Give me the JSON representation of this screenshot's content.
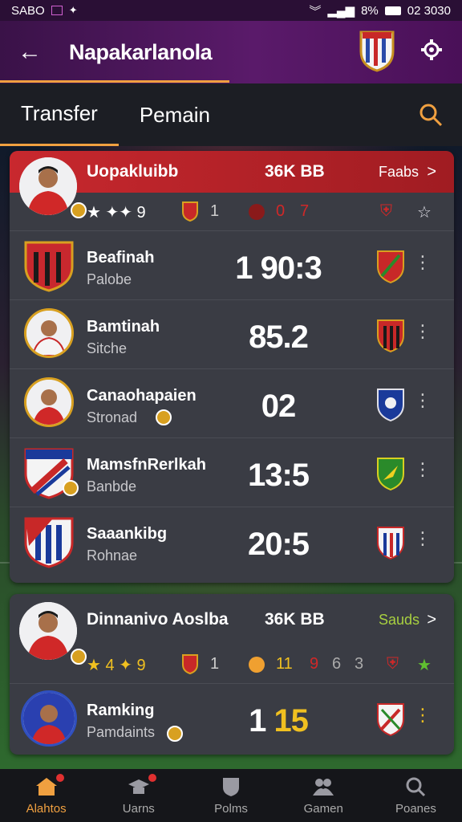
{
  "status_bar": {
    "carrier": "SABO",
    "battery": "8%",
    "time": "02 3030"
  },
  "app_bar": {
    "title": "Napakarlanola"
  },
  "tabs": [
    {
      "label": "Transfer"
    },
    {
      "label": "Pemain"
    }
  ],
  "card1": {
    "header": {
      "name": "Uopakluibb",
      "value": "36K BB",
      "link": "Faabs",
      "chevron": ">"
    },
    "subrow": {
      "stars": "★ ✦✦ 9",
      "num1": "1",
      "dot_num": "0",
      "num2": "7"
    },
    "rows": [
      {
        "name": "Beafinah",
        "sub": "Palobe",
        "score": "1 90:3"
      },
      {
        "name": "Bamtinah",
        "sub": "Sitche",
        "score": "85.2"
      },
      {
        "name": "Canaohapaien",
        "sub": "Stronad",
        "score": "02"
      },
      {
        "name": "MamsfnRerlkah",
        "sub": "Banbde",
        "score": "13:5"
      },
      {
        "name": "Saaankibg",
        "sub": "Rohnae",
        "score": "20:5"
      }
    ]
  },
  "card2": {
    "header": {
      "name": "Dinnanivo Aoslba",
      "value": "36K BB",
      "link": "Sauds",
      "chevron": ">"
    },
    "subrow": {
      "stars": "★ 4 ✦ 9",
      "num1": "1",
      "num2": "11",
      "num3": "9",
      "num4": "6",
      "num5": "3"
    },
    "rows": [
      {
        "name": "Ramking",
        "sub": "Pamdaints",
        "score_a": "1",
        "score_b": "15"
      }
    ]
  },
  "bottom_nav": [
    {
      "label": "Alahtos",
      "icon": "home-icon",
      "active": true
    },
    {
      "label": "Uarns",
      "icon": "cap-icon"
    },
    {
      "label": "Polms",
      "icon": "shield-icon"
    },
    {
      "label": "Gamen",
      "icon": "users-icon"
    },
    {
      "label": "Poanes",
      "icon": "search-icon"
    }
  ],
  "colors": {
    "accent": "#f0a040",
    "header_red": "#c8282e",
    "appbar_purple": "#5a1a6a"
  }
}
